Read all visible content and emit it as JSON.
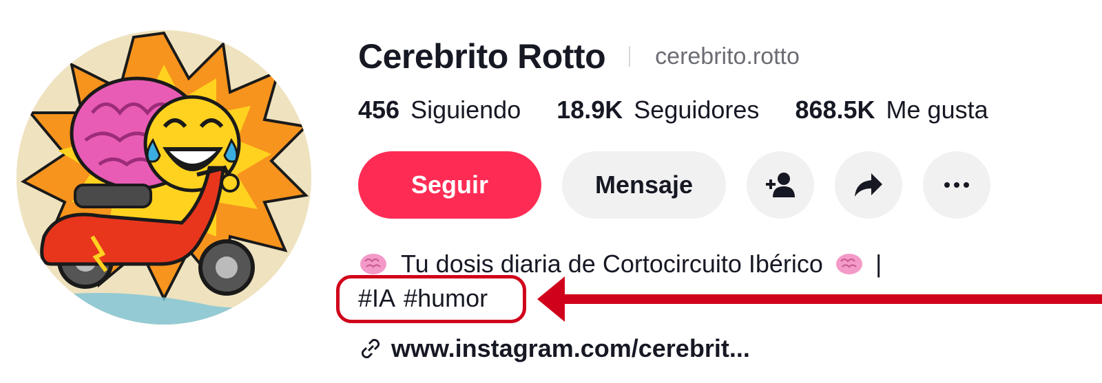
{
  "profile": {
    "display_name": "Cerebrito Rotto",
    "username": "cerebrito.rotto",
    "avatar_icon": "cartoon-brain-on-scooter"
  },
  "stats": [
    {
      "value": "456",
      "label": "Siguiendo"
    },
    {
      "value": "18.9K",
      "label": "Seguidores"
    },
    {
      "value": "868.5K",
      "label": "Me gusta"
    }
  ],
  "actions": {
    "follow_label": "Seguir",
    "message_label": "Mensaje",
    "add_friend_icon": "add-friend-icon",
    "share_icon": "share-icon",
    "more_icon": "more-icon"
  },
  "bio": {
    "text": "Tu dosis diaria de Cortocircuito Ibérico",
    "trailing": "|",
    "emoji_icon": "brain-emoji",
    "hashtags": [
      "#IA",
      "#humor"
    ]
  },
  "link": {
    "text": "www.instagram.com/cerebrit...",
    "icon": "link-icon"
  },
  "colors": {
    "primary": "#fe2c55",
    "secondary_button": "#f1f1f2",
    "text": "#161823",
    "muted": "#6b6c73",
    "annotation": "#d0021b"
  }
}
